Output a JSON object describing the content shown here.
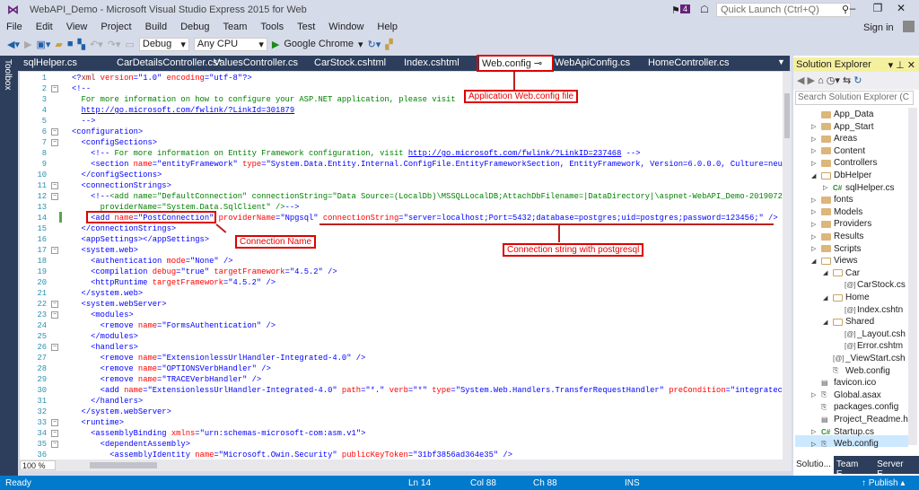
{
  "window": {
    "title": "WebAPI_Demo - Microsoft Visual Studio Express 2015 for Web",
    "notification_count": "4",
    "quick_launch_placeholder": "Quick Launch (Ctrl+Q)",
    "sign_in": "Sign in"
  },
  "menu": [
    "File",
    "Edit",
    "View",
    "Project",
    "Build",
    "Debug",
    "Team",
    "Tools",
    "Test",
    "Window",
    "Help"
  ],
  "toolbar": {
    "configuration": "Debug",
    "platform": "Any CPU",
    "run_target": "Google Chrome"
  },
  "toolbox_label": "Toolbox",
  "tabs": [
    "sqlHelper.cs",
    "CarDetailsController.cs*",
    "ValuesController.cs",
    "CarStock.cshtml",
    "Index.cshtml",
    "Web.config",
    "WebApiConfig.cs",
    "HomeController.cs"
  ],
  "active_tab": "Web.config",
  "code_lines": [
    [
      [
        "t",
        "<?"
      ],
      [
        "x",
        "xml"
      ],
      [
        "a",
        " version"
      ],
      [
        "t",
        "=\"1.0\""
      ],
      [
        "a",
        " encoding"
      ],
      [
        "t",
        "=\"utf-8\"?>"
      ]
    ],
    [
      [
        "t",
        "<!--"
      ]
    ],
    [
      [
        "c",
        "  For more information on how to configure your ASP.NET application, please visit"
      ]
    ],
    [
      [
        "c",
        "  "
      ],
      [
        "u",
        "http://go.microsoft.com/fwlink/?LinkId=301879"
      ]
    ],
    [
      [
        "t",
        "  -->"
      ]
    ],
    [
      [
        "t",
        "<configuration>"
      ]
    ],
    [
      [
        "t",
        "  <configSections>"
      ]
    ],
    [
      [
        "t",
        "    <!--"
      ],
      [
        "c",
        " For more information on Entity Framework configuration, visit "
      ],
      [
        "u",
        "http://go.microsoft.com/fwlink/?LinkID=237468"
      ],
      [
        "t",
        " -->"
      ]
    ],
    [
      [
        "t",
        "    <section"
      ],
      [
        "a",
        " name"
      ],
      [
        "t",
        "="
      ],
      [
        "v",
        "\"entityFramework\""
      ],
      [
        "a",
        " type"
      ],
      [
        "t",
        "="
      ],
      [
        "v",
        "\"System.Data.Entity.Internal.ConfigFile.EntityFrameworkSection, EntityFramework, Version=6.0.0.0, Culture=neu"
      ]
    ],
    [
      [
        "t",
        "  </configSections>"
      ]
    ],
    [
      [
        "t",
        "  <connectionStrings>"
      ]
    ],
    [
      [
        "t",
        "    <!--"
      ],
      [
        "c",
        "<add name=\"DefaultConnection\" connectionString=\"Data Source=(LocalDb)\\MSSQLLocalDB;AttachDbFilename=|DataDirectory|\\aspnet-WebAPI_Demo-2019072"
      ]
    ],
    [
      [
        "c",
        "      providerName=\"System.Data.SqlClient\" />"
      ],
      [
        "t",
        "-->"
      ]
    ],
    [
      [
        "t",
        "    <add"
      ],
      [
        "a",
        " name"
      ],
      [
        "t",
        "="
      ],
      [
        "v",
        "\"PostConnection\""
      ],
      [
        "a",
        " providerName"
      ],
      [
        "t",
        "="
      ],
      [
        "v",
        "\"Npgsql\""
      ],
      [
        "a",
        " connectionString"
      ],
      [
        "t",
        "="
      ],
      [
        "v",
        "\"server=localhost;Port=5432;database=postgres;uid=postgres;password=123456;\""
      ],
      [
        "t",
        " />"
      ]
    ],
    [
      [
        "t",
        "  </connectionStrings>"
      ]
    ],
    [
      [
        "t",
        "  <appSettings></appSettings>"
      ]
    ],
    [
      [
        "t",
        "  <system.web>"
      ]
    ],
    [
      [
        "t",
        "    <authentication"
      ],
      [
        "a",
        " mode"
      ],
      [
        "t",
        "="
      ],
      [
        "v",
        "\"None\""
      ],
      [
        "t",
        " />"
      ]
    ],
    [
      [
        "t",
        "    <compilation"
      ],
      [
        "a",
        " debug"
      ],
      [
        "t",
        "="
      ],
      [
        "v",
        "\"true\""
      ],
      [
        "a",
        " targetFramework"
      ],
      [
        "t",
        "="
      ],
      [
        "v",
        "\"4.5.2\""
      ],
      [
        "t",
        " />"
      ]
    ],
    [
      [
        "t",
        "    <httpRuntime"
      ],
      [
        "a",
        " targetFramework"
      ],
      [
        "t",
        "="
      ],
      [
        "v",
        "\"4.5.2\""
      ],
      [
        "t",
        " />"
      ]
    ],
    [
      [
        "t",
        "  </system.web>"
      ]
    ],
    [
      [
        "t",
        "  <system.webServer>"
      ]
    ],
    [
      [
        "t",
        "    <modules>"
      ]
    ],
    [
      [
        "t",
        "      <remove"
      ],
      [
        "a",
        " name"
      ],
      [
        "t",
        "="
      ],
      [
        "v",
        "\"FormsAuthentication\""
      ],
      [
        "t",
        " />"
      ]
    ],
    [
      [
        "t",
        "    </modules>"
      ]
    ],
    [
      [
        "t",
        "    <handlers>"
      ]
    ],
    [
      [
        "t",
        "      <remove"
      ],
      [
        "a",
        " name"
      ],
      [
        "t",
        "="
      ],
      [
        "v",
        "\"ExtensionlessUrlHandler-Integrated-4.0\""
      ],
      [
        "t",
        " />"
      ]
    ],
    [
      [
        "t",
        "      <remove"
      ],
      [
        "a",
        " name"
      ],
      [
        "t",
        "="
      ],
      [
        "v",
        "\"OPTIONSVerbHandler\""
      ],
      [
        "t",
        " />"
      ]
    ],
    [
      [
        "t",
        "      <remove"
      ],
      [
        "a",
        " name"
      ],
      [
        "t",
        "="
      ],
      [
        "v",
        "\"TRACEVerbHandler\""
      ],
      [
        "t",
        " />"
      ]
    ],
    [
      [
        "t",
        "      <add"
      ],
      [
        "a",
        " name"
      ],
      [
        "t",
        "="
      ],
      [
        "v",
        "\"ExtensionlessUrlHandler-Integrated-4.0\""
      ],
      [
        "a",
        " path"
      ],
      [
        "t",
        "="
      ],
      [
        "v",
        "\"*.\""
      ],
      [
        "a",
        " verb"
      ],
      [
        "t",
        "="
      ],
      [
        "v",
        "\"*\""
      ],
      [
        "a",
        " type"
      ],
      [
        "t",
        "="
      ],
      [
        "v",
        "\"System.Web.Handlers.TransferRequestHandler\""
      ],
      [
        "a",
        " preCondition"
      ],
      [
        "t",
        "="
      ],
      [
        "v",
        "\"integratec"
      ]
    ],
    [
      [
        "t",
        "    </handlers>"
      ]
    ],
    [
      [
        "t",
        "  </system.webServer>"
      ]
    ],
    [
      [
        "t",
        "  <runtime>"
      ]
    ],
    [
      [
        "t",
        "    <assemblyBinding"
      ],
      [
        "a",
        " xmlns"
      ],
      [
        "t",
        "="
      ],
      [
        "v",
        "\"urn:schemas-microsoft-com:asm.v1\""
      ],
      [
        "t",
        ">"
      ]
    ],
    [
      [
        "t",
        "      <dependentAssembly>"
      ]
    ],
    [
      [
        "t",
        "        <assemblyIdentity"
      ],
      [
        "a",
        " name"
      ],
      [
        "t",
        "="
      ],
      [
        "v",
        "\"Microsoft.Owin.Security\""
      ],
      [
        "a",
        " publicKeyToken"
      ],
      [
        "t",
        "="
      ],
      [
        "v",
        "\"31bf3856ad364e35\""
      ],
      [
        "t",
        " />"
      ]
    ]
  ],
  "fold_lines": [
    2,
    6,
    7,
    11,
    12,
    17,
    22,
    23,
    26,
    33,
    34,
    35
  ],
  "annotations": {
    "webconfig": "Application Web.config file",
    "conn_name": "Connection Name",
    "conn_string": "Connection string with postgresql"
  },
  "editor_zoom": "100 %",
  "solution_explorer": {
    "title": "Solution Explorer",
    "search_placeholder": "Search Solution Explorer (C",
    "items": [
      {
        "label": "App_Data",
        "level": 0,
        "exp": "",
        "icon": "folder"
      },
      {
        "label": "App_Start",
        "level": 0,
        "exp": "closed",
        "icon": "folder"
      },
      {
        "label": "Areas",
        "level": 0,
        "exp": "closed",
        "icon": "folder"
      },
      {
        "label": "Content",
        "level": 0,
        "exp": "closed",
        "icon": "folder"
      },
      {
        "label": "Controllers",
        "level": 0,
        "exp": "closed",
        "icon": "folder"
      },
      {
        "label": "DbHelper",
        "level": 0,
        "exp": "open",
        "icon": "folder-open"
      },
      {
        "label": "sqlHelper.cs",
        "level": 1,
        "exp": "closed",
        "icon": "cs"
      },
      {
        "label": "fonts",
        "level": 0,
        "exp": "closed",
        "icon": "folder"
      },
      {
        "label": "Models",
        "level": 0,
        "exp": "closed",
        "icon": "folder"
      },
      {
        "label": "Providers",
        "level": 0,
        "exp": "closed",
        "icon": "folder"
      },
      {
        "label": "Results",
        "level": 0,
        "exp": "closed",
        "icon": "folder"
      },
      {
        "label": "Scripts",
        "level": 0,
        "exp": "closed",
        "icon": "folder"
      },
      {
        "label": "Views",
        "level": 0,
        "exp": "open",
        "icon": "folder-open"
      },
      {
        "label": "Car",
        "level": 1,
        "exp": "open",
        "icon": "folder-open"
      },
      {
        "label": "CarStock.cs",
        "level": 2,
        "exp": "",
        "icon": "razor"
      },
      {
        "label": "Home",
        "level": 1,
        "exp": "open",
        "icon": "folder-open"
      },
      {
        "label": "Index.cshtn",
        "level": 2,
        "exp": "",
        "icon": "razor"
      },
      {
        "label": "Shared",
        "level": 1,
        "exp": "open",
        "icon": "folder-open"
      },
      {
        "label": "_Layout.csh",
        "level": 2,
        "exp": "",
        "icon": "razor"
      },
      {
        "label": "Error.cshtm",
        "level": 2,
        "exp": "",
        "icon": "razor"
      },
      {
        "label": "_ViewStart.csh",
        "level": 1,
        "exp": "",
        "icon": "razor"
      },
      {
        "label": "Web.config",
        "level": 1,
        "exp": "",
        "icon": "config"
      },
      {
        "label": "favicon.ico",
        "level": 0,
        "exp": "",
        "icon": "file"
      },
      {
        "label": "Global.asax",
        "level": 0,
        "exp": "closed",
        "icon": "config"
      },
      {
        "label": "packages.config",
        "level": 0,
        "exp": "",
        "icon": "config"
      },
      {
        "label": "Project_Readme.h",
        "level": 0,
        "exp": "",
        "icon": "file"
      },
      {
        "label": "Startup.cs",
        "level": 0,
        "exp": "closed",
        "icon": "cs"
      },
      {
        "label": "Web.config",
        "level": 0,
        "exp": "closed",
        "icon": "config"
      }
    ],
    "bottom_tabs": [
      "Solutio...",
      "Team E...",
      "Server E..."
    ]
  },
  "status": {
    "state": "Ready",
    "ln": "Ln 14",
    "col": "Col 88",
    "ch": "Ch 88",
    "mode": "INS",
    "publish": "Publish"
  }
}
